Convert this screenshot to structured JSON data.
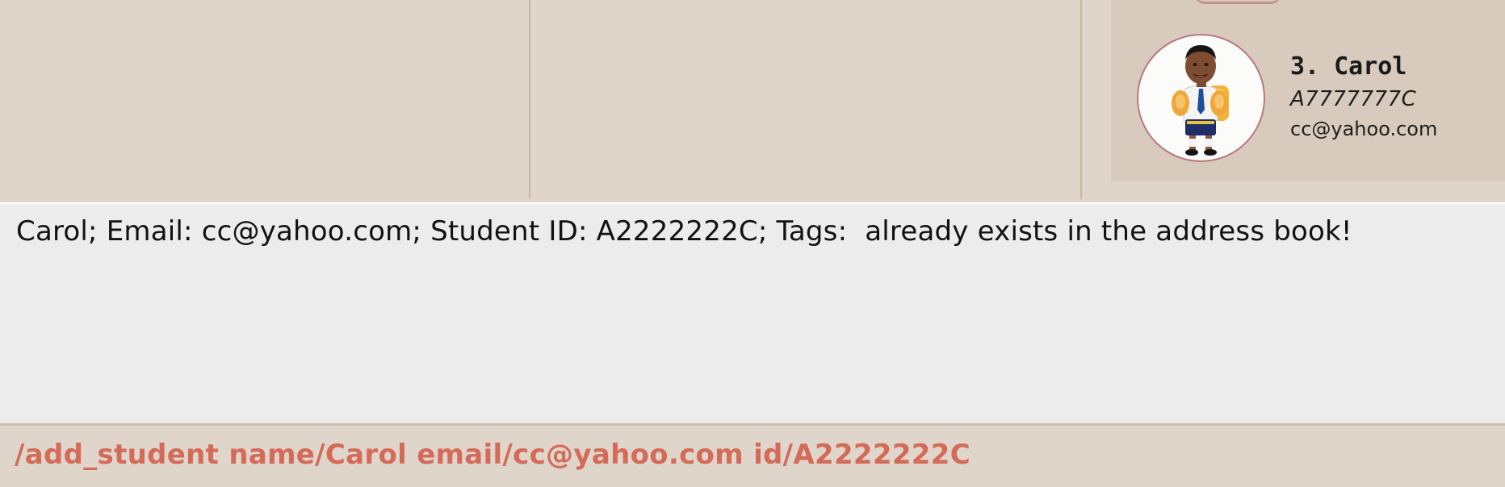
{
  "student_list": {
    "cards": [
      {
        "index": "3.",
        "name": "Carol",
        "student_id": "A7777777C",
        "email": "cc@yahoo.com"
      }
    ]
  },
  "result_display": {
    "message": "Carol; Email: cc@yahoo.com; Student ID: A2222222C; Tags:  already exists in the address book!"
  },
  "command_box": {
    "value": "/add_student name/Carol email/cc@yahoo.com id/A2222222C"
  },
  "colors": {
    "background": "#e0d5cb",
    "card": "#d8cbbe",
    "result_background": "#ececec",
    "command_text": "#d46a58",
    "avatar_border": "#b9787d"
  },
  "icons": {
    "avatar": "student-avatar-image"
  }
}
